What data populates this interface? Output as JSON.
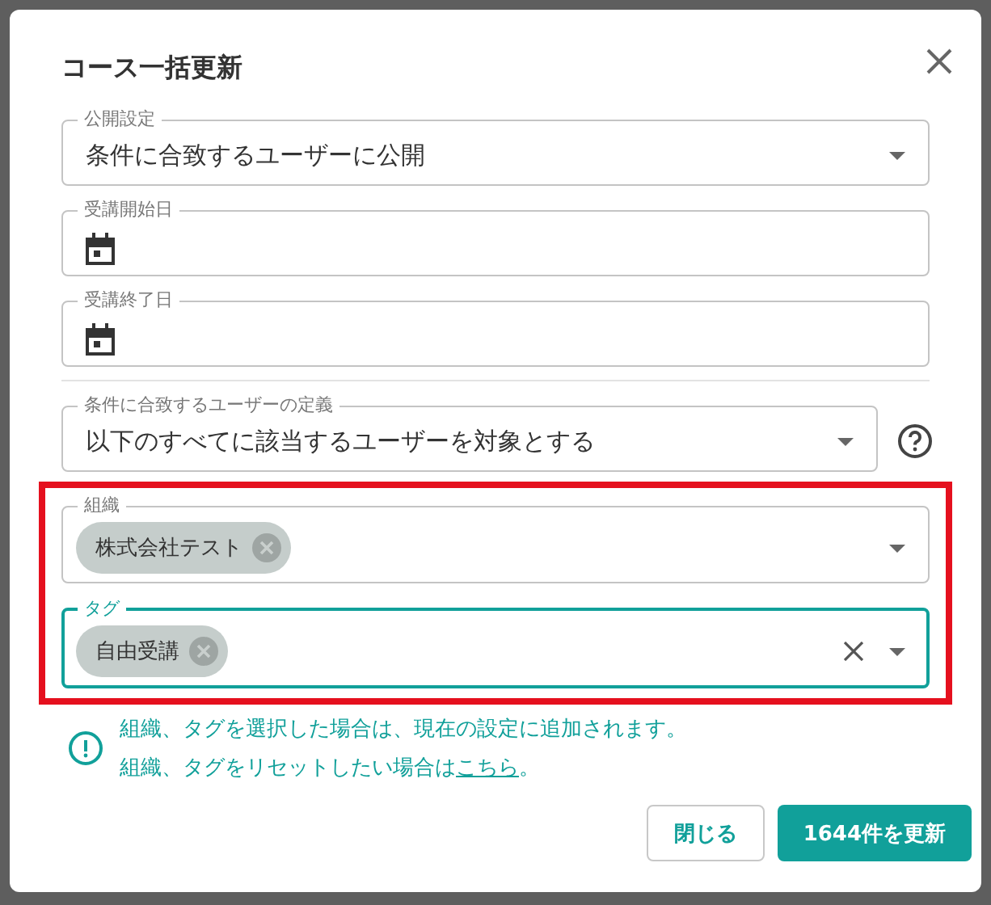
{
  "dialog": {
    "title": "コース一括更新"
  },
  "fields": [
    {
      "kind": "select",
      "label": "公開設定",
      "value": "条件に合致するユーザーに公開"
    },
    {
      "kind": "date",
      "label": "受講開始日"
    },
    {
      "kind": "date",
      "label": "受講終了日"
    }
  ],
  "condition": {
    "label": "条件に合致するユーザーの定義",
    "value": "以下のすべてに該当するユーザーを対象とする"
  },
  "highlighted_fields": [
    {
      "label": "組織",
      "chips": [
        "株式会社テスト"
      ],
      "focused": false,
      "clearable": false
    },
    {
      "label": "タグ",
      "chips": [
        "自由受講"
      ],
      "focused": true,
      "clearable": true
    }
  ],
  "notice": {
    "line_1": "組織、タグを選択した場合は、現在の設定に追加されます。",
    "line_2": "組織、タグをリセットしたい場合は",
    "link": "こちら",
    "line_2_end": "。"
  },
  "buttons": [
    {
      "kind": "outline",
      "label": "閉じる"
    },
    {
      "kind": "primary",
      "label": "1644件を更新"
    }
  ]
}
